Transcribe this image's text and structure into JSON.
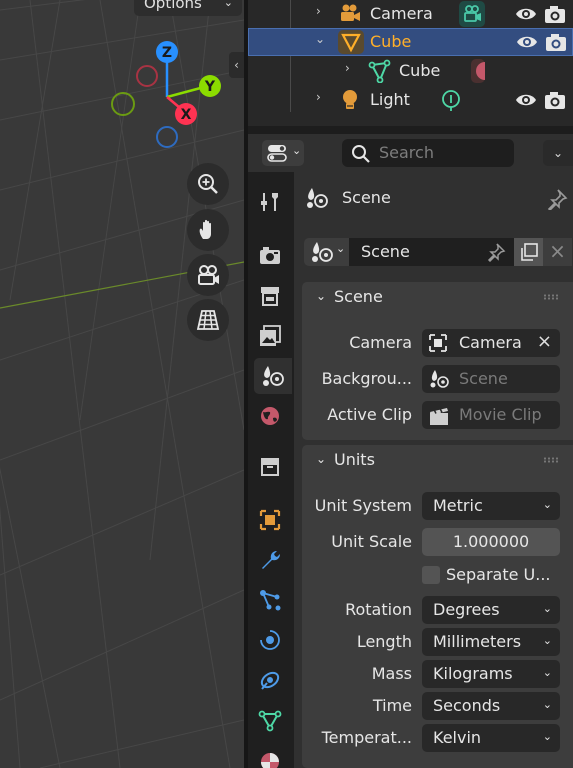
{
  "viewport": {
    "options_label": "Options",
    "gizmo": {
      "x_label": "X",
      "y_label": "Y",
      "z_label": "Z"
    }
  },
  "outliner": {
    "rows": [
      {
        "label": "Camera"
      },
      {
        "label": "Cube"
      },
      {
        "label": "Cube"
      },
      {
        "label": "Light"
      }
    ]
  },
  "properties": {
    "search_placeholder": "Search",
    "context_title": "Scene",
    "datablock_name": "Scene",
    "scene_panel": {
      "title": "Scene",
      "camera_label": "Camera",
      "camera_value": "Camera",
      "background_label": "Backgrou...",
      "background_value": "Scene",
      "active_clip_label": "Active Clip",
      "active_clip_value": "Movie Clip"
    },
    "units_panel": {
      "title": "Units",
      "unit_system_label": "Unit System",
      "unit_system_value": "Metric",
      "unit_scale_label": "Unit Scale",
      "unit_scale_value": "1.000000",
      "separate_units_label": "Separate U...",
      "rotation_label": "Rotation",
      "rotation_value": "Degrees",
      "length_label": "Length",
      "length_value": "Millimeters",
      "mass_label": "Mass",
      "mass_value": "Kilograms",
      "time_label": "Time",
      "time_value": "Seconds",
      "temperature_label": "Temperat...",
      "temperature_value": "Kelvin"
    }
  },
  "colors": {
    "accent_selected": "#334d80",
    "active_object": "#ffaf29",
    "axis_x": "#ff3352",
    "axis_y": "#8bdc00",
    "axis_z": "#2890ff"
  }
}
